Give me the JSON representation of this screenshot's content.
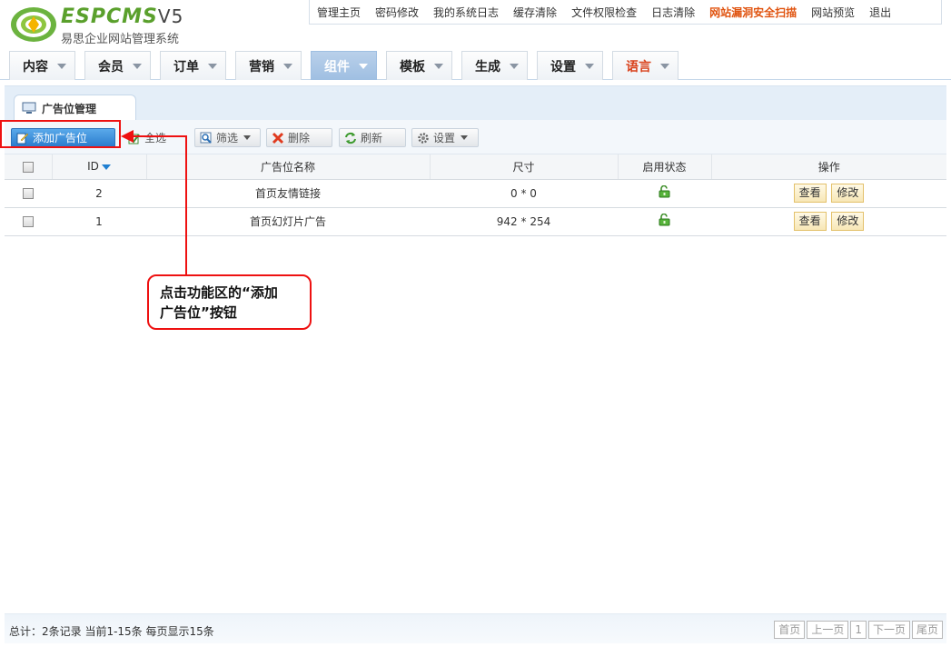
{
  "logo": {
    "brand": "ESPCMS",
    "version": "V5",
    "subtitle": "易思企业网站管理系统"
  },
  "topnav": [
    {
      "label": "管理主页"
    },
    {
      "label": "密码修改"
    },
    {
      "label": "我的系统日志"
    },
    {
      "label": "缓存清除"
    },
    {
      "label": "文件权限检查"
    },
    {
      "label": "日志清除"
    },
    {
      "label": "网站漏洞安全扫描",
      "highlight": true
    },
    {
      "label": "网站预览"
    },
    {
      "label": "退出"
    }
  ],
  "mainnav": [
    {
      "label": "内容"
    },
    {
      "label": "会员"
    },
    {
      "label": "订单"
    },
    {
      "label": "营销"
    },
    {
      "label": "组件",
      "active": true
    },
    {
      "label": "模板"
    },
    {
      "label": "生成"
    },
    {
      "label": "设置"
    },
    {
      "label": "语言",
      "color": "#d9421c"
    }
  ],
  "subtab": {
    "label": "广告位管理"
  },
  "toolbar": {
    "add": "添加广告位",
    "select_all": "全选",
    "filter": "筛选",
    "delete": "删除",
    "refresh": "刷新",
    "settings": "设置"
  },
  "table": {
    "headers": {
      "id": "ID",
      "name": "广告位名称",
      "size": "尺寸",
      "status": "启用状态",
      "ops": "操作"
    },
    "rows": [
      {
        "id": "2",
        "name": "首页友情链接",
        "size": "0 * 0",
        "status": "enabled",
        "view": "查看",
        "edit": "修改"
      },
      {
        "id": "1",
        "name": "首页幻灯片广告",
        "size": "942 * 254",
        "status": "enabled",
        "view": "查看",
        "edit": "修改"
      }
    ]
  },
  "callout": {
    "line1": "点击功能区的“添加",
    "line2": "广告位”按钮"
  },
  "footer": {
    "summary": "总计：2条记录 当前1-15条 每页显示15条",
    "pager": {
      "first": "首页",
      "prev": "上一页",
      "page": "1",
      "next": "下一页",
      "last": "尾页"
    }
  },
  "colors": {
    "accent": "#2b7dce",
    "alert": "#e11111",
    "brand_green": "#5aa02c",
    "highlight": "#e0530f"
  }
}
